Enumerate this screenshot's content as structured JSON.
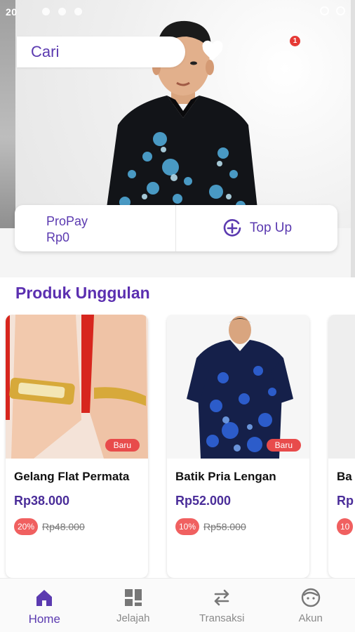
{
  "status_bar": {
    "time": "20"
  },
  "search": {
    "label": "Cari"
  },
  "notifications": {
    "count": "1"
  },
  "wallet": {
    "name": "ProPay",
    "balance": "Rp0",
    "topup_label": "Top Up"
  },
  "section": {
    "title": "Produk Unggulan"
  },
  "products": [
    {
      "name": "Gelang Flat Permata",
      "price": "Rp38.000",
      "discount": "20%",
      "old_price": "Rp48.000",
      "badge": "Baru"
    },
    {
      "name": "Batik Pria Lengan",
      "price": "Rp52.000",
      "discount": "10%",
      "old_price": "Rp58.000",
      "badge": "Baru"
    },
    {
      "name": "Ba",
      "price": "Rp",
      "discount": "10"
    }
  ],
  "nav": [
    {
      "label": "Home",
      "icon": "home-icon",
      "active": true
    },
    {
      "label": "Jelajah",
      "icon": "grid-icon"
    },
    {
      "label": "Transaksi",
      "icon": "swap-icon"
    },
    {
      "label": "Akun",
      "icon": "face-icon"
    }
  ],
  "colors": {
    "primary": "#5b3ab0",
    "badge_red": "#e84b4b",
    "notification_red": "#e53935"
  }
}
